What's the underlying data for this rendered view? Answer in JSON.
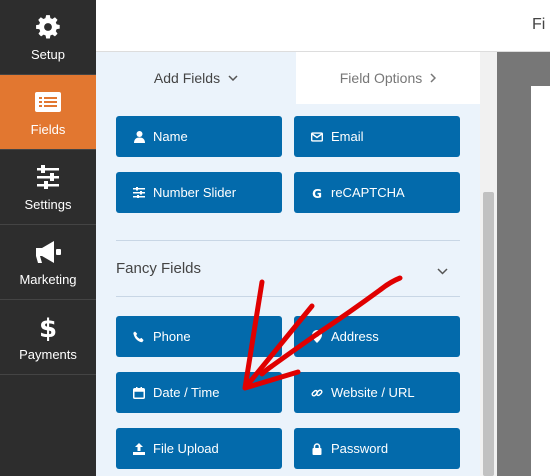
{
  "sidebar": {
    "items": [
      {
        "label": "Setup",
        "icon": "gear-icon"
      },
      {
        "label": "Fields",
        "icon": "fields-list-icon",
        "active": true
      },
      {
        "label": "Settings",
        "icon": "sliders-icon"
      },
      {
        "label": "Marketing",
        "icon": "megaphone-icon"
      },
      {
        "label": "Payments",
        "icon": "dollar-icon"
      }
    ]
  },
  "header": {
    "title_fragment": "Fi"
  },
  "panel": {
    "tabs": [
      {
        "label": "Add Fields",
        "icon": "chevron-down-icon",
        "active": true
      },
      {
        "label": "Field Options",
        "icon": "chevron-right-icon"
      }
    ],
    "standard_fields": [
      {
        "label": "Name",
        "icon": "user-icon"
      },
      {
        "label": "Email",
        "icon": "envelope-icon"
      },
      {
        "label": "Number Slider",
        "icon": "sliders-icon"
      },
      {
        "label": "reCAPTCHA",
        "icon": "google-icon"
      }
    ],
    "fancy_section_title": "Fancy Fields",
    "fancy_fields": [
      {
        "label": "Phone",
        "icon": "phone-icon"
      },
      {
        "label": "Address",
        "icon": "map-pin-icon"
      },
      {
        "label": "Date / Time",
        "icon": "calendar-icon"
      },
      {
        "label": "Website / URL",
        "icon": "link-icon"
      },
      {
        "label": "File Upload",
        "icon": "upload-icon"
      },
      {
        "label": "Password",
        "icon": "lock-icon"
      }
    ]
  },
  "colors": {
    "nav_bg": "#2d2d2d",
    "nav_active": "#e27730",
    "field_button": "#036aab",
    "panel_bg": "#ebf3fb",
    "annotation_arrow": "#e00000"
  }
}
